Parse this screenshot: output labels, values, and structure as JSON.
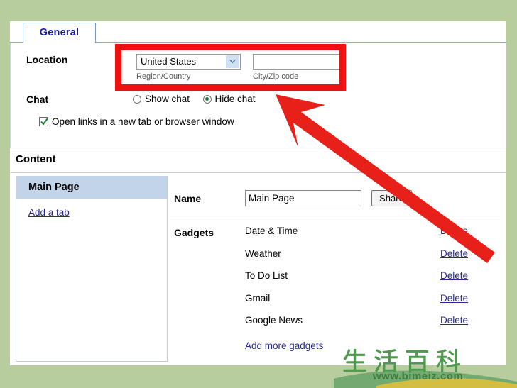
{
  "window": {
    "background_color": "#b7cd9e",
    "panel_color": "#ffffff"
  },
  "tabs": {
    "items": [
      {
        "label": "General",
        "selected": true
      }
    ]
  },
  "general": {
    "location": {
      "label": "Location",
      "country_select": {
        "value": "United States",
        "caption": "Region/Country",
        "arrow_icon": "chevron-down-icon"
      },
      "zip_input": {
        "value": "",
        "placeholder": "",
        "caption": "City/Zip code"
      }
    },
    "chat": {
      "label": "Chat",
      "options": [
        {
          "label": "Show chat",
          "selected": false
        },
        {
          "label": "Hide chat",
          "selected": true
        }
      ]
    },
    "open_links": {
      "label": "Open links in a new tab or browser window",
      "checked": true
    }
  },
  "content": {
    "heading": "Content",
    "sidebar": {
      "header": "Main Page",
      "add_tab_link": "Add a tab"
    },
    "detail": {
      "name_label": "Name",
      "name_value": "Main Page",
      "share_label": "Share",
      "gadgets_label": "Gadgets",
      "gadgets": [
        {
          "name": "Date & Time",
          "action": "Delete"
        },
        {
          "name": "Weather",
          "action": "Delete"
        },
        {
          "name": "To Do List",
          "action": "Delete"
        },
        {
          "name": "Gmail",
          "action": "Delete"
        },
        {
          "name": "Google News",
          "action": "Delete"
        }
      ],
      "add_more_link": "Add more gadgets"
    }
  },
  "annotations": {
    "highlight_color": "#ee1111",
    "arrow_color": "#e8201a"
  },
  "watermark": {
    "cjk_text": "生活百科",
    "url_text": "www.bimeiz.com",
    "color": "#4e9a4e"
  }
}
